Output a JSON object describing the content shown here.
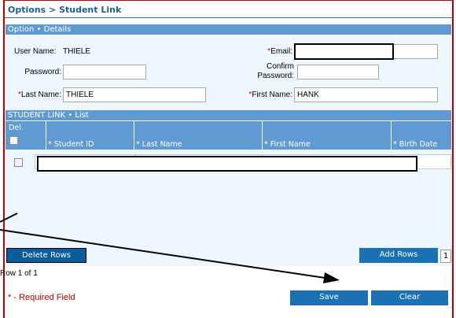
{
  "breadcrumb": "Options > Student Link",
  "details_header": "Option • Details",
  "form": {
    "user_name_label": "User Name:",
    "user_name_value": "THIELE",
    "email_label": "Email:",
    "email_value": "",
    "password_label": "Password:",
    "password_value": "",
    "confirm_label_1": "Confirm",
    "confirm_label_2": "Password:",
    "confirm_value": "",
    "last_name_label": "Last Name:",
    "last_name_value": "THIELE",
    "first_name_label": "First Name:",
    "first_name_value": "HANK",
    "required_marker": "*"
  },
  "list_header": "STUDENT LINK • List",
  "grid": {
    "columns": [
      "Del.",
      "* Student ID",
      "* Last Name",
      "* First Name",
      "* Birth Date"
    ],
    "rows": [
      {
        "student_id": "",
        "last_name": "",
        "first_name": "",
        "birth_date": ""
      }
    ]
  },
  "buttons": {
    "delete_rows": "Delete Rows",
    "add_rows": "Add Rows",
    "add_rows_count": "1",
    "save": "Save",
    "clear": "Clear"
  },
  "row_status": "Row 1 of 1",
  "required_note": "* - Required Field",
  "colors": {
    "accent": "#5f9bd2",
    "button": "#1a72b5",
    "required": "#c00000",
    "panel": "#eef6ff"
  }
}
